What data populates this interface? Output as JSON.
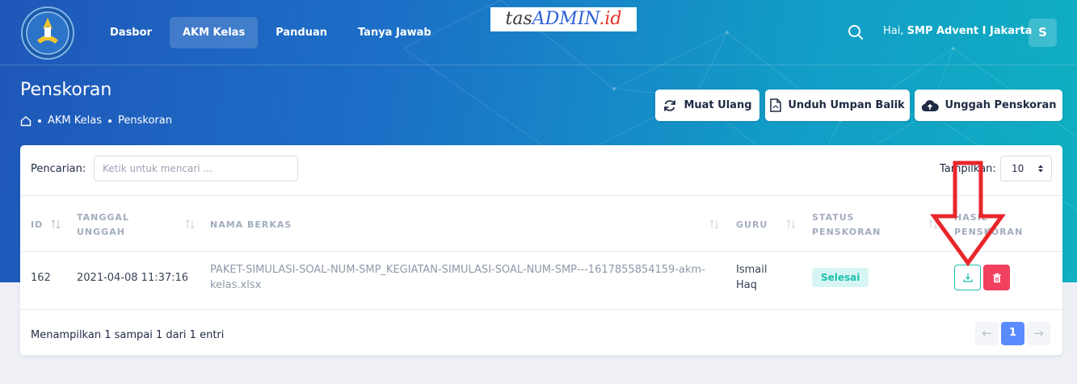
{
  "header": {
    "nav": [
      "Dasbor",
      "AKM Kelas",
      "Panduan",
      "Tanya Jawab"
    ],
    "active_nav": "AKM Kelas",
    "watermark": {
      "part1": "tas",
      "part2": "ADMIN",
      "part3": ".id"
    },
    "greeting_prefix": "Hai,",
    "user_name": "SMP Advent I Jakarta",
    "avatar_letter": "S"
  },
  "page": {
    "title": "Penskoran",
    "breadcrumb": [
      "AKM Kelas",
      "Penskoran"
    ],
    "actions": {
      "reload": "Muat Ulang",
      "download_feedback": "Unduh Umpan Balik",
      "upload_scoring": "Unggah Penskoran"
    }
  },
  "table": {
    "search_label": "Pencarian:",
    "search_placeholder": "Ketik untuk mencari ...",
    "show_label": "Tampilkan:",
    "page_size": "10",
    "columns": {
      "id": "ID",
      "tanggal_line1": "TANGGAL",
      "tanggal_line2": "UNGGAH",
      "nama": "NAMA BERKAS",
      "guru": "GURU",
      "status_line1": "STATUS",
      "status_line2": "PENSKORAN",
      "hasil_line1": "HASIL",
      "hasil_line2": "PENSKORAN"
    },
    "rows": [
      {
        "id": "162",
        "tanggal": "2021-04-08 11:37:16",
        "nama_line1": "PAKET-SIMULASI-SOAL-NUM-SMP_KEGIATAN-SIMULASI-SOAL-NUM-SMP---1617855854159-akm-",
        "nama_line2": "kelas.xlsx",
        "guru_line1": "Ismail",
        "guru_line2": "Haq",
        "status": "Selesai"
      }
    ],
    "footer_info": "Menampilkan 1 sampai 1 dari 1 entri",
    "pagination": {
      "prev": "←",
      "current": "1",
      "next": "→"
    }
  },
  "colors": {
    "header_gradient_start": "#1f57b8",
    "header_gradient_end": "#0fb0c2",
    "status_badge_bg": "#d7f6f3",
    "status_badge_text": "#1dbfae",
    "delete_button": "#f1415f",
    "active_page": "#5b8cff",
    "annotation_arrow": "#e8262a"
  }
}
